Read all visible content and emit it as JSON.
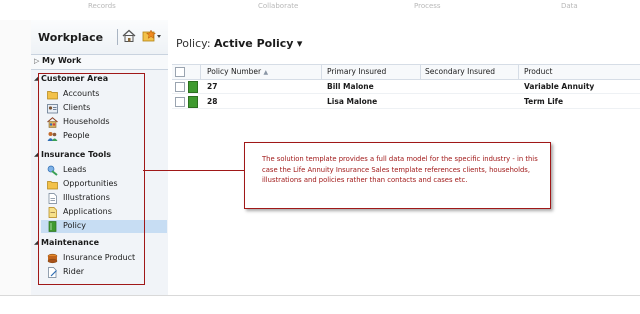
{
  "ribbon_groups": [
    "Records",
    "Collaborate",
    "Process",
    "Data"
  ],
  "nav": {
    "title": "Workplace",
    "home_icon": "home-icon",
    "favorites_icon": "favorites-icon",
    "my_work": "My Work",
    "sections": [
      {
        "label": "Customer Area",
        "items": [
          {
            "label": "Accounts",
            "icon": "folder-icon"
          },
          {
            "label": "Clients",
            "icon": "contact-card-icon"
          },
          {
            "label": "Households",
            "icon": "household-icon"
          },
          {
            "label": "People",
            "icon": "people-icon"
          }
        ]
      },
      {
        "label": "Insurance Tools",
        "items": [
          {
            "label": "Leads",
            "icon": "leads-icon"
          },
          {
            "label": "Opportunities",
            "icon": "folder-icon"
          },
          {
            "label": "Illustrations",
            "icon": "document-icon"
          },
          {
            "label": "Applications",
            "icon": "document-icon"
          },
          {
            "label": "Policy",
            "icon": "policy-icon"
          }
        ]
      },
      {
        "label": "Maintenance",
        "items": [
          {
            "label": "Insurance Product",
            "icon": "product-icon"
          },
          {
            "label": "Rider",
            "icon": "document-edit-icon"
          }
        ]
      }
    ]
  },
  "main": {
    "view_prefix": "Policy:",
    "view_name": "Active Policy",
    "view_chevron": "▾",
    "columns": [
      "Policy Number",
      "Primary Insured",
      "Secondary Insured",
      "Product"
    ],
    "sort_glyph": "▲",
    "rows": [
      {
        "policy_number": "27",
        "primary_insured": "Bill Malone",
        "secondary_insured": "",
        "product": "Variable Annuity"
      },
      {
        "policy_number": "28",
        "primary_insured": "Lisa Malone",
        "secondary_insured": "",
        "product": "Term Life"
      }
    ]
  },
  "annotation": {
    "text": "The solution template provides a full data model for the specific industry - in this case the Life Annuity Insurance Sales template references clients, households, illustrations and policies rather than contacts and cases etc."
  },
  "colors": {
    "annotation": "#a01818",
    "selected": "#c7ddf3",
    "record": "#3f9a2f"
  }
}
